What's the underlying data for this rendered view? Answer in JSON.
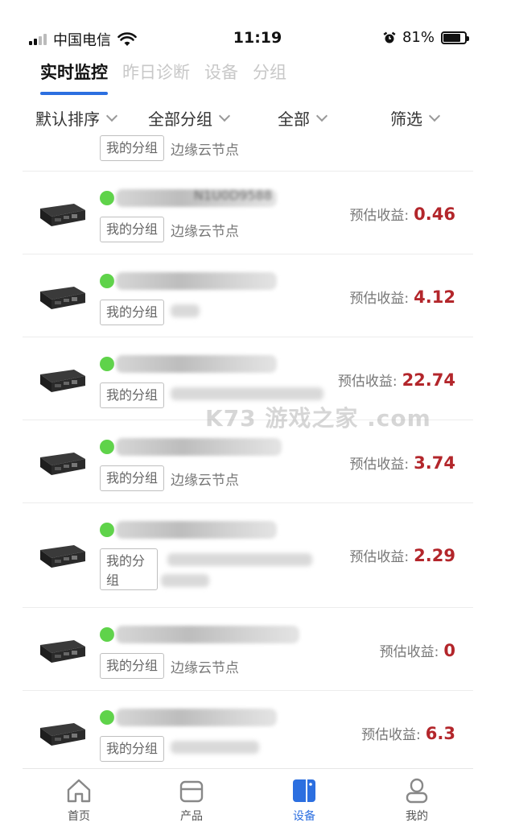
{
  "status_bar": {
    "carrier": "中国电信",
    "time": "11:19",
    "battery": "81%"
  },
  "top_tabs": [
    {
      "label": "实时监控",
      "active": true
    },
    {
      "label": "昨日诊断",
      "active": false
    },
    {
      "label": "设备",
      "active": false
    },
    {
      "label": "分组",
      "active": false
    }
  ],
  "filters": [
    {
      "label": "默认排序"
    },
    {
      "label": "全部分组"
    },
    {
      "label": "全部"
    },
    {
      "label": "筛选"
    }
  ],
  "devices": [
    {
      "group": "我的分组",
      "node": "边缘云节点",
      "earnings_label": "预估收益:",
      "earnings": ""
    },
    {
      "group": "我的分组",
      "node": "边缘云节点",
      "earnings_label": "预估收益:",
      "earnings": "0.46",
      "name_partial": "N1U0D9588"
    },
    {
      "group": "我的分组",
      "node": "",
      "earnings_label": "预估收益:",
      "earnings": "4.12"
    },
    {
      "group": "我的分组",
      "node": "",
      "earnings_label": "预估收益:",
      "earnings": "22.74"
    },
    {
      "group": "我的分组",
      "node": "边缘云节点",
      "earnings_label": "预估收益:",
      "earnings": "3.74"
    },
    {
      "group": "我的分组",
      "node": "",
      "earnings_label": "预估收益:",
      "earnings": "2.29"
    },
    {
      "group": "我的分组",
      "node": "边缘云节点",
      "earnings_label": "预估收益:",
      "earnings": "0"
    },
    {
      "group": "我的分组",
      "node": "",
      "earnings_label": "预估收益:",
      "earnings": "6.3"
    }
  ],
  "watermark": "K73 游戏之家 .com",
  "bottom_nav": [
    {
      "label": "首页",
      "icon": "home-icon",
      "active": false
    },
    {
      "label": "产品",
      "icon": "box-icon",
      "active": false
    },
    {
      "label": "设备",
      "icon": "device-icon",
      "active": true
    },
    {
      "label": "我的",
      "icon": "user-icon",
      "active": false
    }
  ],
  "colors": {
    "accent": "#2c6fe0",
    "earnings": "#b3262b",
    "online": "#5fd34a"
  }
}
